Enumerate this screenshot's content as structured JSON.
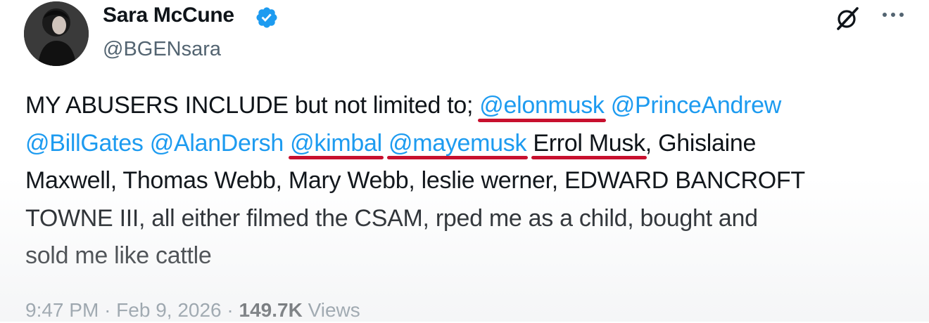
{
  "author": {
    "display_name": "Sara McCune",
    "handle": "@BGENsara",
    "verified": true
  },
  "icons": {
    "verified": "verified-badge-icon",
    "grok": "grok-icon",
    "more": "more-options-icon",
    "verified_color": "#1d9bf0"
  },
  "tweet": {
    "line1": {
      "text": "MY ABUSERS INCLUDE but not limited to; ",
      "mention1": "@elonmusk",
      "mention2": "@PrinceAndrew"
    },
    "line2": {
      "mention1": "@BillGates",
      "mention2": "@AlanDersh",
      "mention3": "@kimbal",
      "mention4": "@mayemusk",
      "name": "Errol Musk",
      "text_after": ", Ghislaine"
    },
    "line3": "Maxwell, Thomas Webb, Mary Webb, leslie werner, EDWARD BANCROFT",
    "line4": "TOWNE III, all either filmed the CSAM, rped me as a child, bought and",
    "line5": "sold me like cattle"
  },
  "meta": {
    "time": "9:47 PM",
    "date": "Feb 9, 2026",
    "views_count": "149.7K",
    "views_label": "Views"
  },
  "colors": {
    "mention": "#1d9bf0",
    "underline_annotation": "#c8102e",
    "secondary_text": "#536471",
    "primary_text": "#0f1419"
  }
}
